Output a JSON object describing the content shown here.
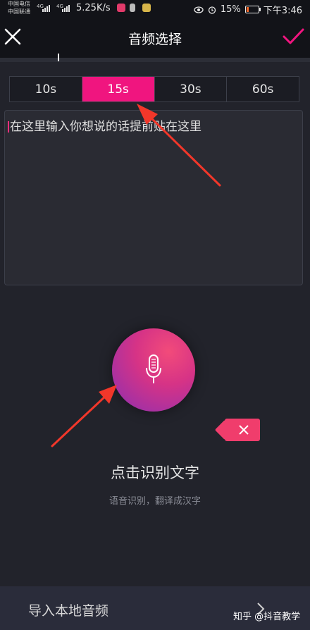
{
  "status_bar": {
    "carrier1": "中国电信",
    "carrier2": "中国联通",
    "net1": "4G",
    "net2": "4G",
    "speed": "5.25K/s",
    "battery": "15%",
    "time": "下午3:46"
  },
  "header": {
    "title": "音频选择",
    "close_icon": "close-icon",
    "confirm_icon": "check-icon"
  },
  "durations": [
    {
      "label": "10s",
      "active": false
    },
    {
      "label": "15s",
      "active": true
    },
    {
      "label": "30s",
      "active": false
    },
    {
      "label": "60s",
      "active": false
    }
  ],
  "text_input": {
    "value": "在这里输入你想说的话提前贴在这里"
  },
  "voice": {
    "prompt": "点击识别文字",
    "hint": "语音识别，翻译成汉字",
    "mic_icon": "microphone-icon",
    "delete_icon": "delete-icon"
  },
  "bottom": {
    "import_label": "导入本地音频",
    "chevron_icon": "chevron-right-icon"
  },
  "watermark": "知乎 @抖音教学",
  "colors": {
    "accent": "#f0157f",
    "background": "#22232b",
    "bar": "#121318",
    "arrow": "#f2372a"
  }
}
